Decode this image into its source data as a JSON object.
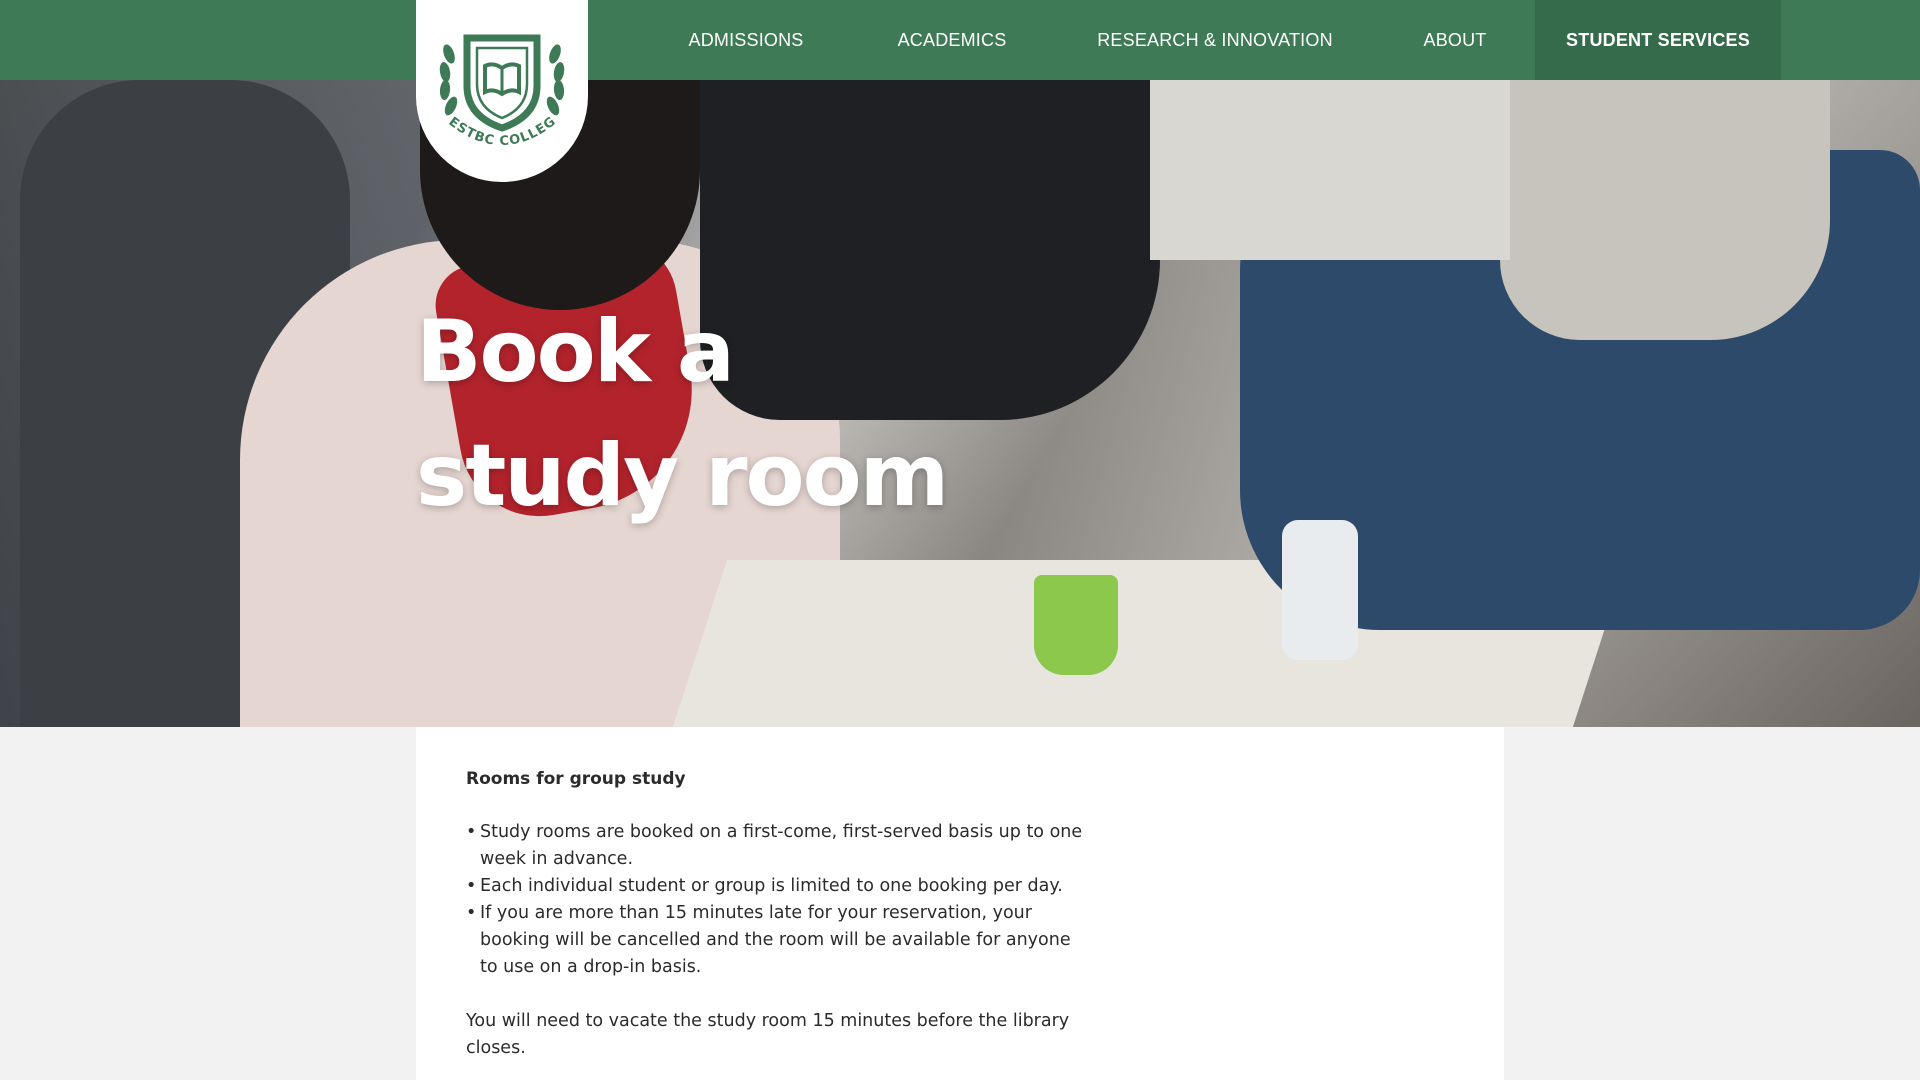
{
  "colors": {
    "nav_background": "#3d7a55",
    "nav_active_background": "#356b4b",
    "logo_green": "#3d7a55",
    "page_background": "#f2f2f2"
  },
  "logo": {
    "text": "BESTBC COLLEGE",
    "icon": "open-book-shield-icon"
  },
  "nav": {
    "items": [
      {
        "label": "ADMISSIONS",
        "active": false
      },
      {
        "label": "ACADEMICS",
        "active": false
      },
      {
        "label": "RESEARCH & INNOVATION",
        "active": false
      },
      {
        "label": "ABOUT",
        "active": false
      },
      {
        "label": "STUDENT SERVICES",
        "active": true
      }
    ]
  },
  "hero": {
    "title_line1": "Book a",
    "title_line2": "study room"
  },
  "content": {
    "heading": "Rooms for group study",
    "bullet_char": "•",
    "bullets": [
      "Study rooms are booked on a first-come, first-served basis up to one week in advance.",
      "Each individual student or group is limited to one booking per day.",
      "If you are more than 15 minutes late for your reservation, your booking will be cancelled and the room will be available for anyone to use on a drop-in basis."
    ],
    "closing": "You will need to vacate the study room 15 minutes before the library closes."
  }
}
